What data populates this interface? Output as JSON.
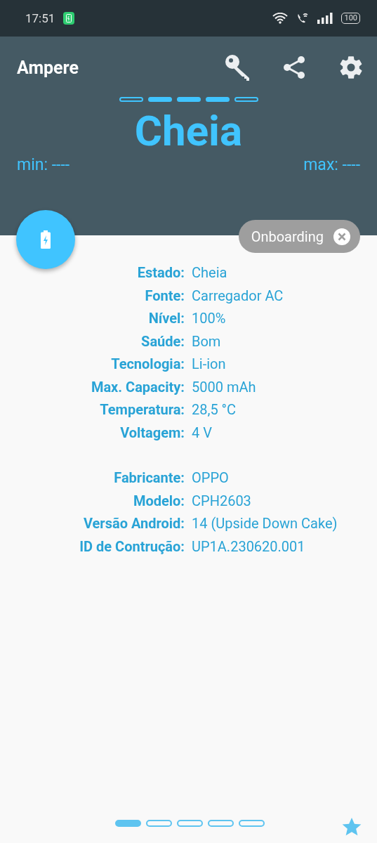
{
  "status_bar": {
    "time": "17:51",
    "battery": "100"
  },
  "app_bar": {
    "title": "Ampere"
  },
  "charge_segments": [
    {
      "filled": false
    },
    {
      "filled": true
    },
    {
      "filled": true
    },
    {
      "filled": true
    },
    {
      "filled": false
    }
  ],
  "state_title": "Cheia",
  "min": "min: ----",
  "max": "max: ----",
  "chip": {
    "label": "Onboarding"
  },
  "battery_info": [
    {
      "label": "Estado:",
      "value": "Cheia"
    },
    {
      "label": "Fonte:",
      "value": "Carregador AC"
    },
    {
      "label": "Nível:",
      "value": "100%"
    },
    {
      "label": "Saúde:",
      "value": "Bom"
    },
    {
      "label": "Tecnologia:",
      "value": "Li-ion"
    },
    {
      "label": "Max. Capacity:",
      "value": "5000 mAh"
    },
    {
      "label": "Temperatura:",
      "value": "28,5 °C"
    },
    {
      "label": "Voltagem:",
      "value": "4 V"
    }
  ],
  "device_info": [
    {
      "label": "Fabricante:",
      "value": "OPPO"
    },
    {
      "label": "Modelo:",
      "value": "CPH2603"
    },
    {
      "label": "Versão Android:",
      "value": "14 (Upside Down Cake)"
    },
    {
      "label": "ID de Contrução:",
      "value": "UP1A.230620.001"
    }
  ],
  "pages": [
    {
      "selected": true
    },
    {
      "selected": false
    },
    {
      "selected": false
    },
    {
      "selected": false
    },
    {
      "selected": false
    }
  ]
}
